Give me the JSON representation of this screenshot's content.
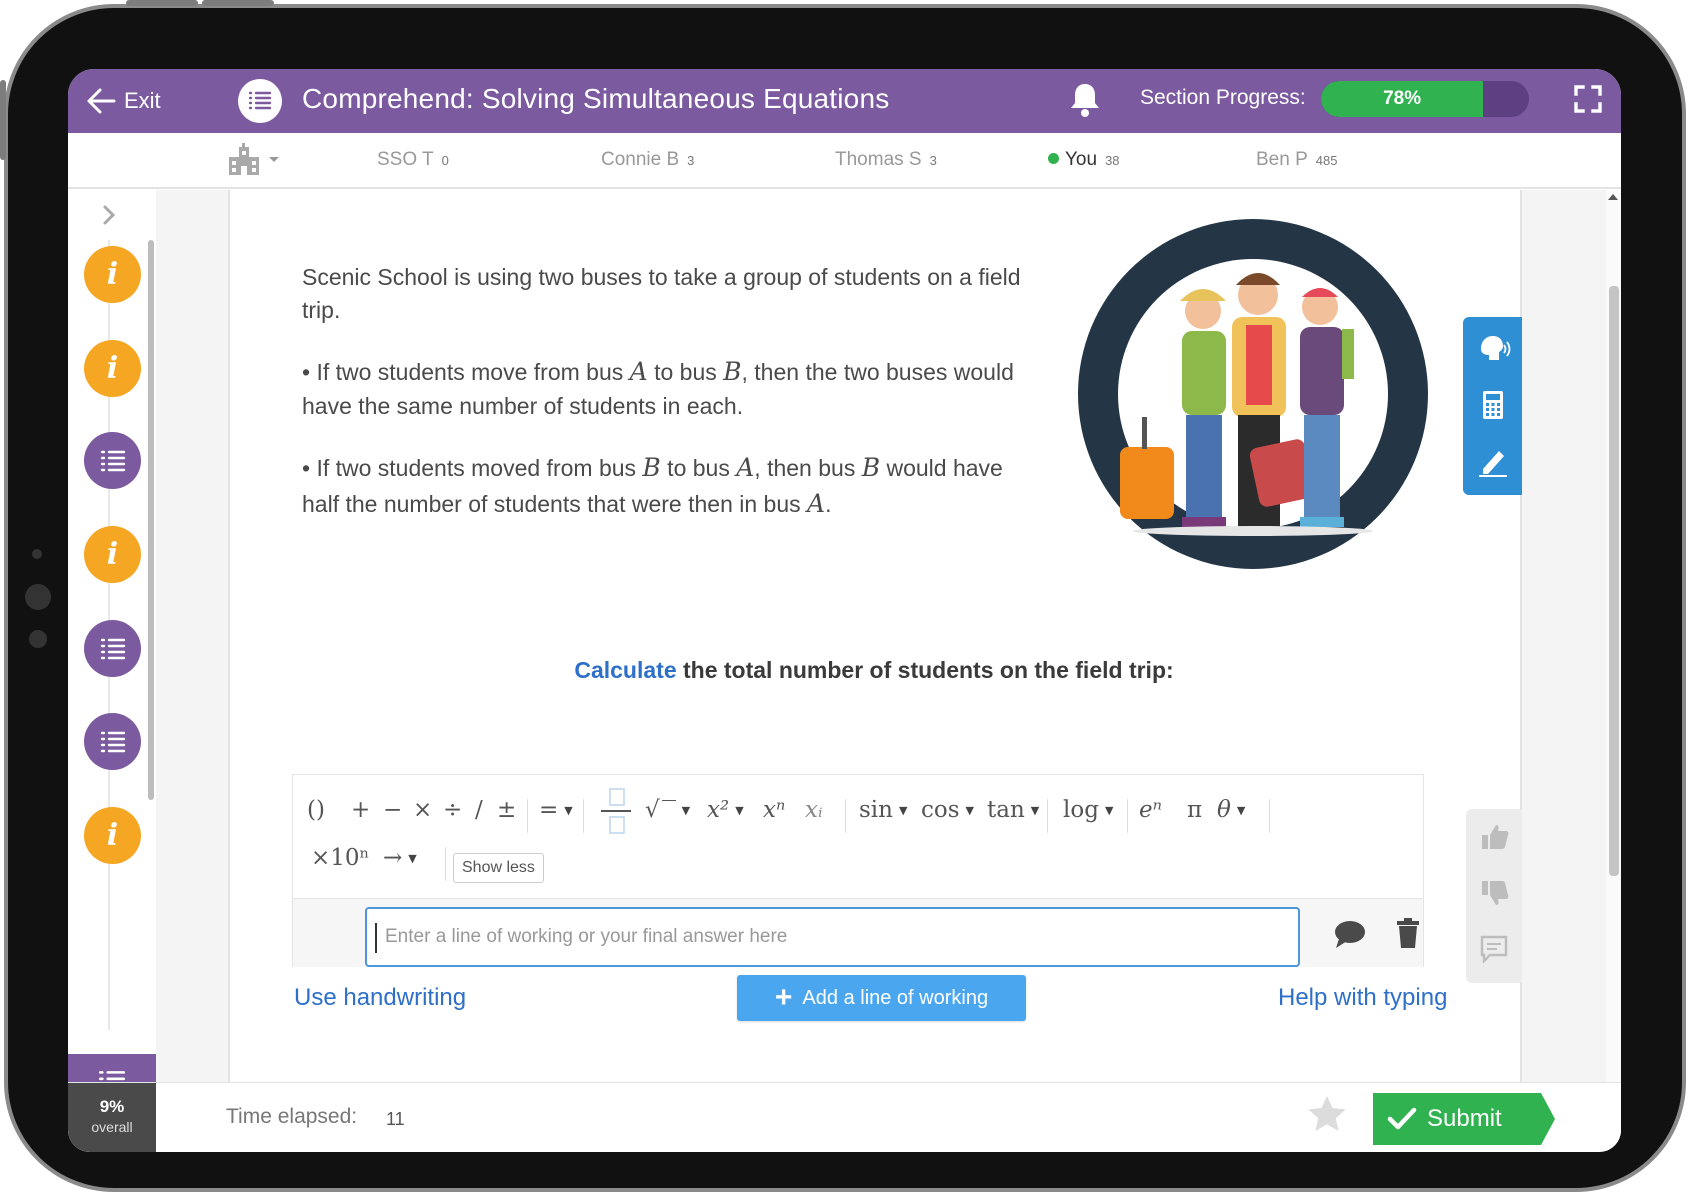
{
  "header": {
    "exit_label": "Exit",
    "title": "Comprehend: Solving Simultaneous Equations",
    "progress_label": "Section Progress:",
    "progress_percent": 78,
    "progress_text": "78%",
    "brand_color": "#7b5aa0",
    "progress_color": "#2fb24f"
  },
  "leaderboard": [
    {
      "name": "SSO T",
      "score": "0"
    },
    {
      "name": "Connie B",
      "score": "3"
    },
    {
      "name": "Thomas S",
      "score": "3"
    },
    {
      "name": "You",
      "score": "38"
    },
    {
      "name": "Ben P",
      "score": "485"
    }
  ],
  "rail": {
    "nodes": [
      "info",
      "info",
      "list",
      "info",
      "list",
      "list",
      "info",
      "list-active"
    ],
    "info_glyph": "i",
    "overall_percent": "9%",
    "overall_label": "overall"
  },
  "question": {
    "intro": "Scenic School is using two buses to take a group of students on a field trip.",
    "b1_p1": "• If two students move from bus ",
    "b1_v1": "A",
    "b1_p2": " to bus ",
    "b1_v2": "B",
    "b1_p3": ", then the two buses would have the same number of students in each.",
    "b2_p1": "• If two students moved from bus ",
    "b2_v1": "B",
    "b2_p2": " to bus ",
    "b2_v2": "A",
    "b2_p3": ", then bus ",
    "b2_v3": "B",
    "b2_p4": " would have half the number of students that were then in bus ",
    "b2_v4": "A",
    "b2_p5": "."
  },
  "prompt": {
    "keyword": "Calculate",
    "rest": " the total number of students on the field trip:"
  },
  "toolbar": {
    "parens": "()",
    "plus": "+",
    "minus": "−",
    "times": "×",
    "divide": "÷",
    "slash": "/",
    "plusminus": "±",
    "equals": "=",
    "sqrt": "√",
    "square": "x²",
    "power": "xⁿ",
    "subscript": "xᵢ",
    "sin": "sin",
    "cos": "cos",
    "tan": "tan",
    "log": "log",
    "exp": "eⁿ",
    "pi": "π",
    "theta": "θ",
    "sci": "×10ⁿ",
    "arrow": "→",
    "show_less": "Show less"
  },
  "answer": {
    "placeholder": "Enter a line of working or your final answer here"
  },
  "actions": {
    "use_handwriting": "Use handwriting",
    "add_line": "Add a line of working",
    "help_typing": "Help with typing",
    "add_color": "#4aa7ef"
  },
  "footer": {
    "time_label": "Time elapsed:",
    "time_value": "11",
    "submit": "Submit"
  }
}
